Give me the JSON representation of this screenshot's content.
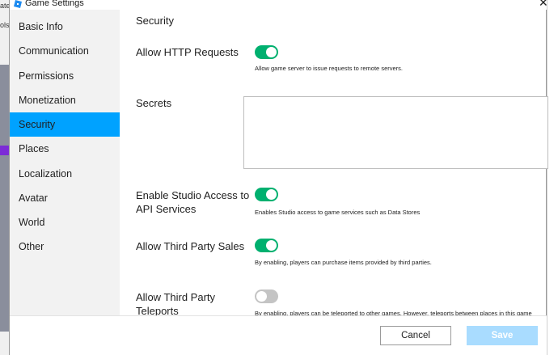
{
  "background": {
    "left_text_1": "ate",
    "left_text_2": "ols"
  },
  "window": {
    "title": "Game Settings",
    "close_glyph": "✕"
  },
  "sidebar": {
    "items": [
      {
        "label": "Basic Info"
      },
      {
        "label": "Communication"
      },
      {
        "label": "Permissions"
      },
      {
        "label": "Monetization"
      },
      {
        "label": "Security"
      },
      {
        "label": "Places"
      },
      {
        "label": "Localization"
      },
      {
        "label": "Avatar"
      },
      {
        "label": "World"
      },
      {
        "label": "Other"
      }
    ],
    "active_index": 4
  },
  "content": {
    "section_title": "Security",
    "http": {
      "label": "Allow HTTP Requests",
      "enabled": true,
      "description": "Allow game server to issue requests to remote servers."
    },
    "secrets": {
      "label": "Secrets",
      "value": ""
    },
    "studio_access": {
      "label_line1": "Enable Studio Access to",
      "label_line2": "API Services",
      "enabled": true,
      "description": "Enables Studio access to game services such as Data Stores"
    },
    "third_party_sales": {
      "label": "Allow Third Party Sales",
      "enabled": true,
      "description": "By enabling, players can purchase items provided by third parties."
    },
    "third_party_teleports": {
      "label_line1": "Allow Third Party",
      "label_line2": "Teleports",
      "enabled": false,
      "description": "By enabling, players can be teleported to other games. However, teleports between places in this game"
    }
  },
  "footer": {
    "cancel_label": "Cancel",
    "save_label": "Save"
  },
  "colors": {
    "active_nav": "#00a2ff",
    "toggle_on": "#00b06f",
    "toggle_off": "#c4c4c4",
    "save_disabled": "#a9dcff"
  }
}
